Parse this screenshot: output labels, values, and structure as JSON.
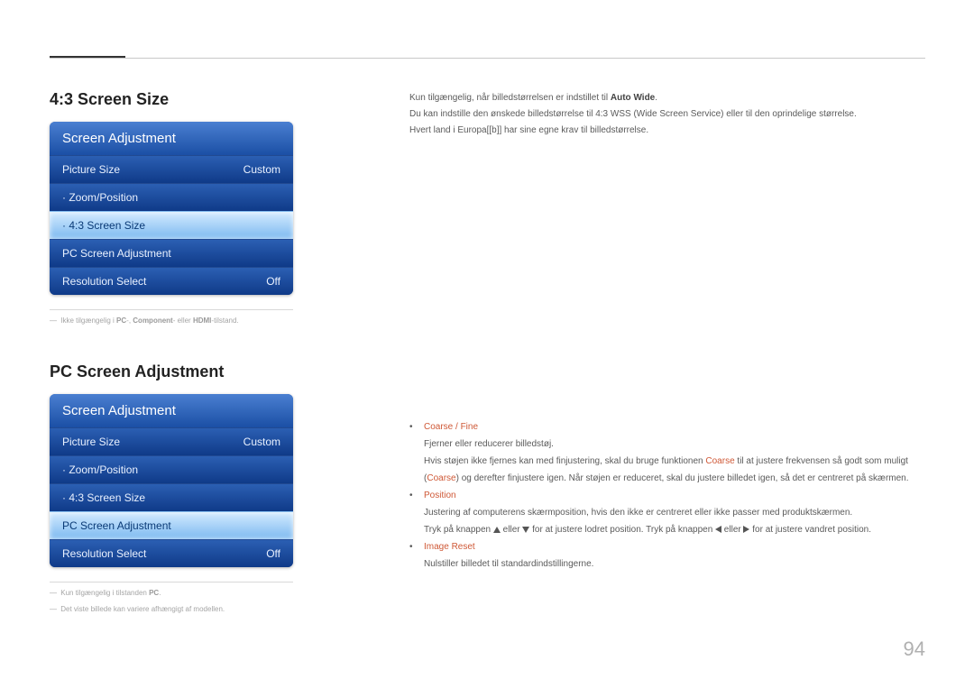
{
  "page_number": "94",
  "section1": {
    "title": "4:3 Screen Size",
    "menu_header": "Screen Adjustment",
    "items": [
      {
        "label": "Picture Size",
        "value": "Custom",
        "sel": false,
        "dot": false
      },
      {
        "label": "Zoom/Position",
        "value": "",
        "sel": false,
        "dot": true
      },
      {
        "label": "4:3 Screen Size",
        "value": "",
        "sel": true,
        "dot": true
      },
      {
        "label": "PC Screen Adjustment",
        "value": "",
        "sel": false,
        "dot": false
      },
      {
        "label": "Resolution Select",
        "value": "Off",
        "sel": false,
        "dot": false
      }
    ],
    "footnote_prefix": "―",
    "footnote_a": "Ikke tilgængelig i ",
    "footnote_b_bold1": "PC",
    "footnote_c": "-, ",
    "footnote_d": "Component",
    "footnote_e": "- eller ",
    "footnote_f_bold2": "HDMI",
    "footnote_g": "-tilstand."
  },
  "section2": {
    "title": "PC Screen Adjustment",
    "menu_header": "Screen Adjustment",
    "items": [
      {
        "label": "Picture Size",
        "value": "Custom",
        "sel": false,
        "dot": false
      },
      {
        "label": "Zoom/Position",
        "value": "",
        "sel": false,
        "dot": true
      },
      {
        "label": "4:3 Screen Size",
        "value": "",
        "sel": false,
        "dot": true
      },
      {
        "label": "PC Screen Adjustment",
        "value": "",
        "sel": true,
        "dot": false
      },
      {
        "label": "Resolution Select",
        "value": "Off",
        "sel": false,
        "dot": false
      }
    ],
    "footnote1_prefix": "―",
    "footnote1_a": "Kun tilgængelig i tilstanden ",
    "footnote1_bold": "PC",
    "footnote1_b": ".",
    "footnote2_prefix": "―",
    "footnote2": "Det viste billede kan variere afhængigt af modellen."
  },
  "right1": {
    "p1_a": "Kun tilgængelig, når billedstørrelsen er indstillet til ",
    "p1_bold": "Auto Wide",
    "p1_b": ".",
    "p2": "Du kan indstille den ønskede billedstørrelse til 4:3 WSS (Wide Screen Service) eller til den oprindelige størrelse.",
    "p3": "Hvert land i Europa[[b]] har sine egne krav til billedstørrelse."
  },
  "right2": {
    "b1_head": "Coarse / Fine",
    "b1_l1": "Fjerner eller reducerer billedstøj.",
    "b1_l2_a": "Hvis støjen ikke fjernes kan med finjustering, skal du bruge funktionen ",
    "b1_l2_bold1": "Coarse",
    "b1_l2_b": " til at justere frekvensen så godt som muligt (",
    "b1_l2_bold2": "Coarse",
    "b1_l2_c": ") og derefter finjustere igen. Når støjen er reduceret, skal du justere billedet igen, så det er centreret på skærmen.",
    "b2_head": "Position",
    "b2_l1": "Justering af computerens skærmposition, hvis den ikke er centreret eller ikke passer med produktskærmen.",
    "b2_l2_a": "Tryk på knappen ",
    "b2_l2_b": " eller ",
    "b2_l2_c": " for at justere lodret position. Tryk på knappen ",
    "b2_l2_d": " eller ",
    "b2_l2_e": " for at justere vandret position.",
    "b3_head": "Image Reset",
    "b3_l1": "Nulstiller billedet til standardindstillingerne."
  }
}
